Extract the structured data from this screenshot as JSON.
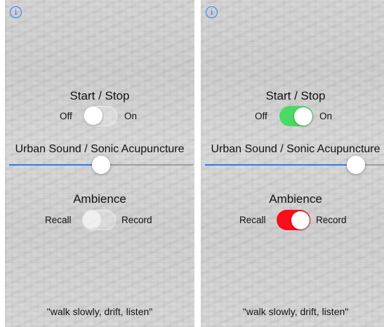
{
  "screens": [
    {
      "info_icon": "i",
      "start_stop": {
        "title": "Start / Stop",
        "off_label": "Off",
        "on_label": "On",
        "state": "off"
      },
      "sound_slider": {
        "label": "Urban Sound / Sonic Acupuncture",
        "value": 0.5
      },
      "ambience": {
        "title": "Ambience",
        "left_label": "Recall",
        "right_label": "Record",
        "state": "off"
      },
      "footer": "\"walk slowly, drift, listen\""
    },
    {
      "info_icon": "i",
      "start_stop": {
        "title": "Start / Stop",
        "off_label": "Off",
        "on_label": "On",
        "state": "on"
      },
      "sound_slider": {
        "label": "Urban Sound / Sonic Acupuncture",
        "value": 0.82
      },
      "ambience": {
        "title": "Ambience",
        "left_label": "Recall",
        "right_label": "Record",
        "state": "on"
      },
      "footer": "\"walk slowly, drift, listen\""
    }
  ],
  "colors": {
    "accent": "#2f7cf6",
    "switch_on_green": "#4cd964",
    "switch_on_red": "#fc0d1b"
  }
}
